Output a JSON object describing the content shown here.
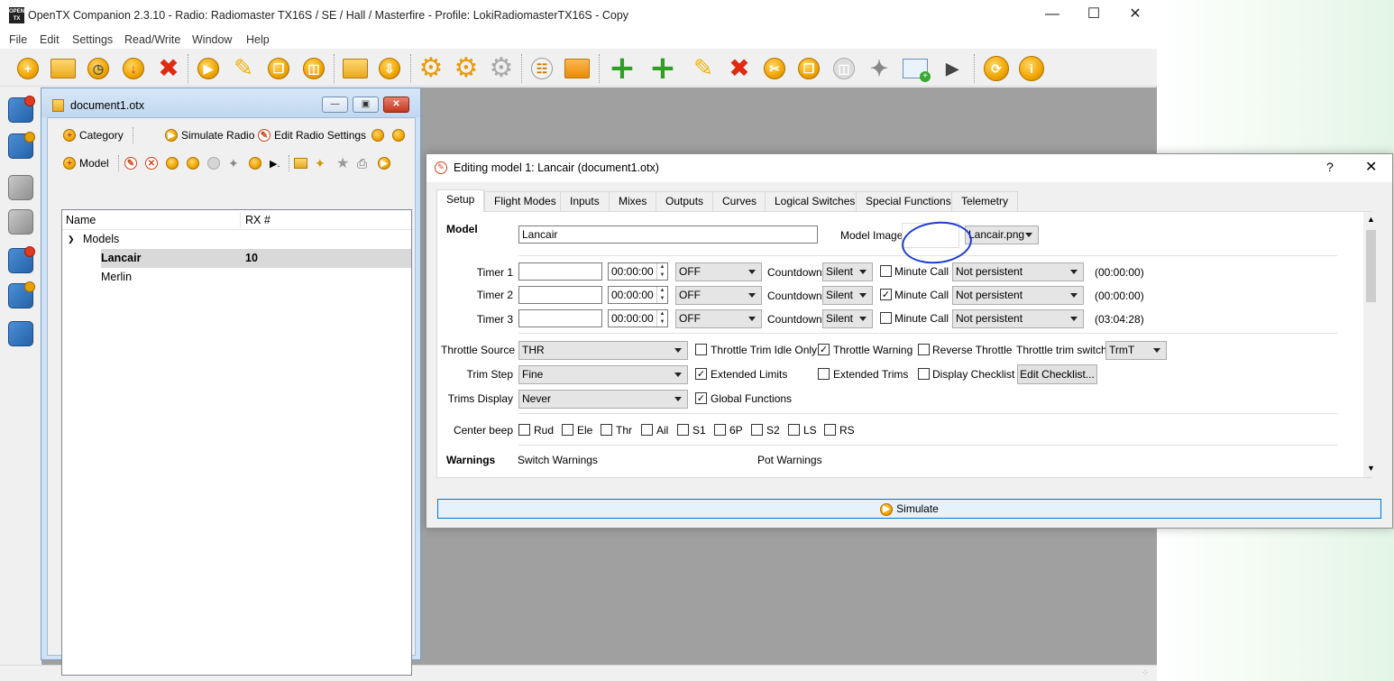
{
  "window": {
    "title": "OpenTX Companion 2.3.10 - Radio: Radiomaster TX16S / SE / Hall / Masterfire - Profile: LokiRadiomasterTX16S - Copy",
    "logo_text": "OPEN TX"
  },
  "menu": [
    "File",
    "Edit",
    "Settings",
    "Read/Write",
    "Window",
    "Help"
  ],
  "toolbar_icons": [
    "new-icon",
    "open-folder-icon",
    "recent-icon",
    "save-icon",
    "close-icon",
    "simulate-icon",
    "edit-icon",
    "copy-icon",
    "paste-icon",
    "read-folder-icon",
    "write-icon",
    "settings-icon",
    "profile-icon",
    "disabled-icon",
    "radio-log-icon",
    "sd-sync-icon",
    "add-icon",
    "add-icon",
    "edit-icon",
    "delete-icon",
    "cut-icon",
    "copy-icon",
    "paste-icon",
    "wizard-icon",
    "window-add-icon",
    "more-icon",
    "update-icon",
    "info-icon"
  ],
  "document": {
    "title": "document1.otx",
    "category_label": "Category",
    "simulate_radio_label": "Simulate Radio",
    "edit_radio_settings_label": "Edit Radio Settings",
    "model_label": "Model",
    "tree": {
      "headers": [
        "Name",
        "RX #"
      ],
      "group": "Models",
      "items": [
        {
          "name": "Lancair",
          "rx": "10"
        },
        {
          "name": "Merlin",
          "rx": ""
        }
      ]
    }
  },
  "editor": {
    "title": "Editing model 1: Lancair  (document1.otx)",
    "help": "?",
    "tabs": [
      "Setup",
      "Flight Modes",
      "Inputs",
      "Mixes",
      "Outputs",
      "Curves",
      "Logical Switches",
      "Special Functions",
      "Telemetry"
    ],
    "section_model": "Model",
    "model_name": "Lancair",
    "model_image_label": "Model Image",
    "model_image_file": "Lancair.png",
    "timers": [
      {
        "label": "Timer 1",
        "name": "",
        "time": "00:00:00",
        "mode": "OFF",
        "countdown_label": "Countdown",
        "countdown": "Silent",
        "minute_call_label": "Minute Call",
        "minute_call": false,
        "persistent": "Not persistent",
        "value": "(00:00:00)"
      },
      {
        "label": "Timer 2",
        "name": "",
        "time": "00:00:00",
        "mode": "OFF",
        "countdown_label": "Countdown",
        "countdown": "Silent",
        "minute_call_label": "Minute Call",
        "minute_call": true,
        "persistent": "Not persistent",
        "value": "(00:00:00)"
      },
      {
        "label": "Timer 3",
        "name": "",
        "time": "00:00:00",
        "mode": "OFF",
        "countdown_label": "Countdown",
        "countdown": "Silent",
        "minute_call_label": "Minute Call",
        "minute_call": false,
        "persistent": "Not persistent",
        "value": "(03:04:28)"
      }
    ],
    "throttle_source_label": "Throttle Source",
    "throttle_source": "THR",
    "throttle_trim_idle_label": "Throttle Trim Idle Only",
    "throttle_warning_label": "Throttle Warning",
    "reverse_throttle_label": "Reverse Throttle",
    "throttle_trim_switch_label": "Throttle trim switch",
    "throttle_trim_switch": "TrmT",
    "trim_step_label": "Trim Step",
    "trim_step": "Fine",
    "extended_limits_label": "Extended Limits",
    "extended_trims_label": "Extended Trims",
    "display_checklist_label": "Display Checklist",
    "edit_checklist_label": "Edit Checklist...",
    "trims_display_label": "Trims Display",
    "trims_display": "Never",
    "global_functions_label": "Global Functions",
    "center_beep_label": "Center beep",
    "center_beep": [
      "Rud",
      "Ele",
      "Thr",
      "Ail",
      "S1",
      "6P",
      "S2",
      "LS",
      "RS"
    ],
    "warnings_label": "Warnings",
    "switch_warnings_label": "Switch Warnings",
    "pot_warnings_label": "Pot Warnings",
    "simulate_label": "Simulate"
  }
}
